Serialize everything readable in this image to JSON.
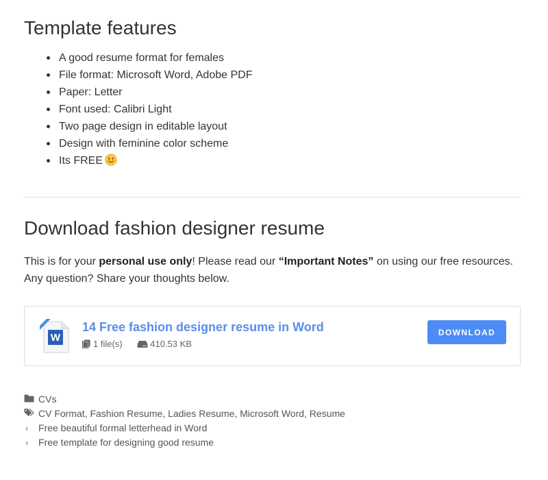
{
  "features_section": {
    "heading": "Template features",
    "items": [
      "A good resume format for females",
      "File format: Microsoft Word, Adobe PDF",
      "Paper: Letter",
      "Font used: Calibri Light",
      "Two page design in editable layout",
      "Design with feminine color scheme",
      "Its FREE"
    ]
  },
  "download_section": {
    "heading": "Download fashion designer resume",
    "intro": {
      "part1": "This is for your ",
      "bold1": "personal use only",
      "part2": "! Please read our ",
      "bold2": "“Important Notes”",
      "part3": " on using our free resources. Any question? Share your thoughts below."
    },
    "card": {
      "title": "14 Free fashion designer resume in Word",
      "file_count": "1 file(s)",
      "file_size": "410.53 KB",
      "button_label": "DOWNLOAD",
      "icon": "word-doc-icon",
      "accent_color": "#4d8cf4"
    }
  },
  "post_meta": {
    "category": "CVs",
    "tags": [
      "CV Format",
      "Fashion Resume",
      "Ladies Resume",
      "Microsoft Word",
      "Resume"
    ],
    "tag_separator": ", ",
    "prev_post": "Free beautiful formal letterhead in Word",
    "next_post": "Free template for designing good resume"
  }
}
